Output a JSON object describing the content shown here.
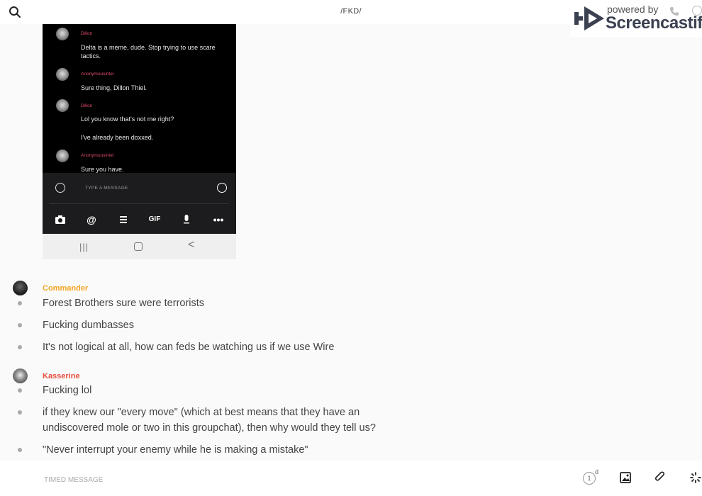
{
  "header": {
    "title": "/FKD/",
    "search_icon": "search-icon"
  },
  "watermark": {
    "powered_by": "powered by",
    "brand": "Screencastify"
  },
  "phone_screenshot": {
    "messages": [
      {
        "sender": "Dillon",
        "lines": [
          "Delta is a meme, dude. Stop trying to use scare tactics."
        ]
      },
      {
        "sender": "Anonymousintel",
        "lines": [
          "Sure thing, Dillon Thiel."
        ]
      },
      {
        "sender": "Dillon",
        "lines": [
          "Lol you know that's not me right?",
          "I've already been doxxed."
        ]
      },
      {
        "sender": "Anonymousintel",
        "lines": [
          "Sure you have."
        ]
      }
    ],
    "input_placeholder": "TYPE A MESSAGE",
    "toolbar": [
      "camera-icon",
      "mention-icon",
      "format-icon",
      "GIF",
      "microphone-icon",
      "more-icon"
    ],
    "nav": [
      "recent-apps-icon",
      "home-icon",
      "back-icon"
    ]
  },
  "conversation": [
    {
      "sender": "Commander",
      "sender_color": "#f5a623",
      "messages": [
        "Forest Brothers sure were terrorists",
        "Fucking dumbasses",
        "It's not logical at all, how can feds be watching us if we use Wire"
      ]
    },
    {
      "sender": "Kasserine",
      "sender_color": "#e74c3c",
      "messages": [
        "Fucking lol",
        "if they knew our \"every move\" (which at best means that they have an undiscovered mole or two in this groupchat), then why would they tell us?",
        "\"Never interrupt your enemy while he is making a mistake\""
      ]
    }
  ],
  "composer": {
    "placeholder": "TIMED MESSAGE",
    "timer_value": "1",
    "timer_unit": "d",
    "icons": [
      "timer-icon",
      "image-icon",
      "attachment-icon",
      "ping-icon"
    ]
  }
}
